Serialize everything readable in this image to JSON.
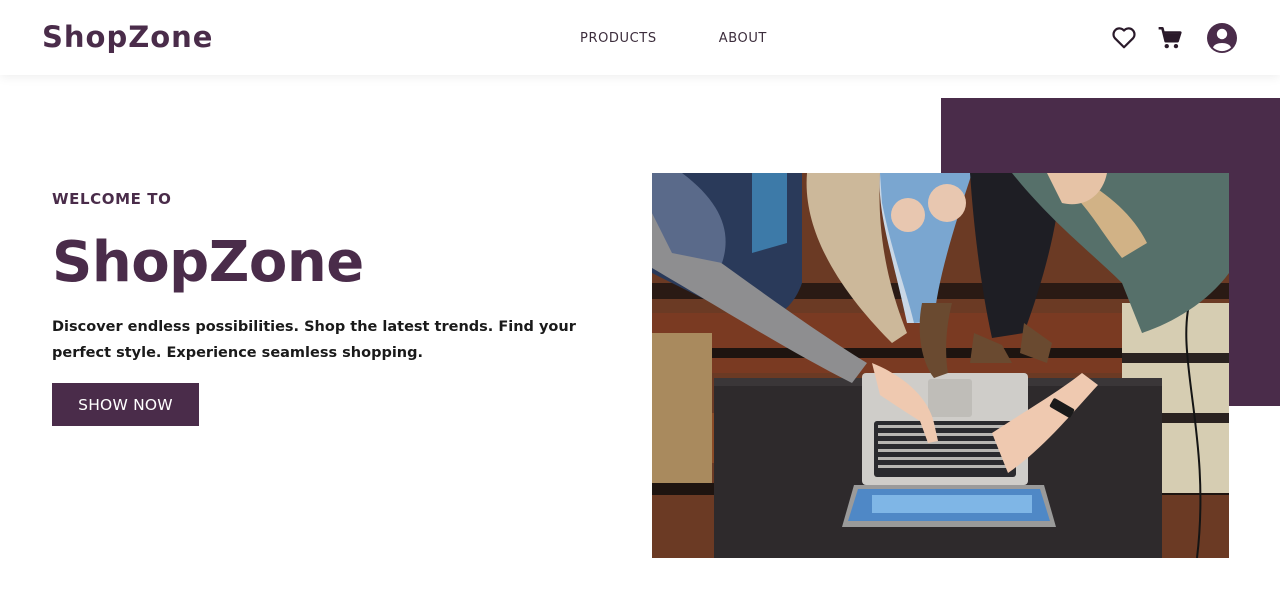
{
  "nav": {
    "logo": "ShopZone",
    "links": [
      "PRODUCTS",
      "ABOUT"
    ],
    "icons": [
      "heart-icon",
      "cart-icon",
      "account-icon"
    ]
  },
  "hero": {
    "eyebrow": "WELCOME TO",
    "title": "ShopZone",
    "tagline": "Discover endless possibilities. Shop the latest trends. Find your perfect style. Experience seamless shopping.",
    "cta_label": "SHOW NOW",
    "image_description": "people-using-laptop-and-tablet-photo"
  },
  "colors": {
    "brand": "#4a2c4a",
    "text": "#1a1a1a",
    "background": "#ffffff"
  }
}
